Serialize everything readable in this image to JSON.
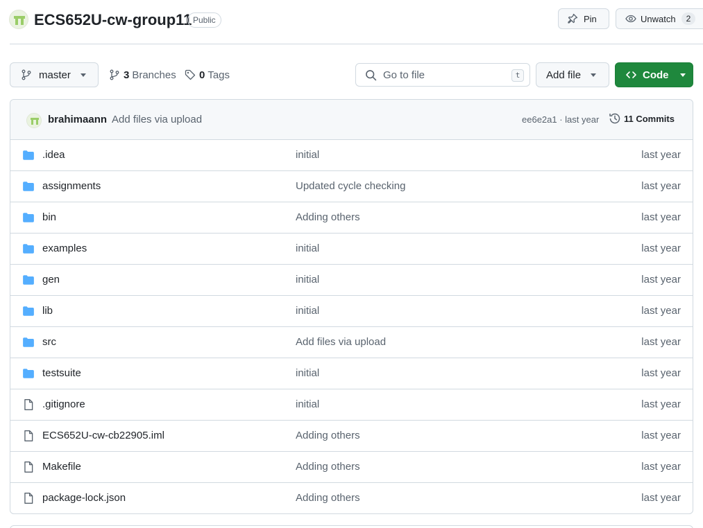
{
  "repo": {
    "name": "ECS652U-cw-group11",
    "visibility": "Public"
  },
  "actions": {
    "pin_label": "Pin",
    "watch_label": "Unwatch",
    "watch_count": "2"
  },
  "toolbar": {
    "branch": "master",
    "branches_count": "3",
    "branches_label": "Branches",
    "tags_count": "0",
    "tags_label": "Tags",
    "search_placeholder": "Go to file",
    "search_shortcut": "t",
    "add_file_label": "Add file",
    "code_label": "Code"
  },
  "latest_commit": {
    "author": "brahimaann",
    "message": "Add files via upload",
    "meta": "ee6e2a1 · last year",
    "commits_label": "11 Commits"
  },
  "files": [
    {
      "name": ".idea",
      "type": "folder",
      "message": "initial",
      "age": "last year"
    },
    {
      "name": "assignments",
      "type": "folder",
      "message": "Updated cycle checking",
      "age": "last year"
    },
    {
      "name": "bin",
      "type": "folder",
      "message": "Adding others",
      "age": "last year"
    },
    {
      "name": "examples",
      "type": "folder",
      "message": "initial",
      "age": "last year"
    },
    {
      "name": "gen",
      "type": "folder",
      "message": "initial",
      "age": "last year"
    },
    {
      "name": "lib",
      "type": "folder",
      "message": "initial",
      "age": "last year"
    },
    {
      "name": "src",
      "type": "folder",
      "message": "Add files via upload",
      "age": "last year"
    },
    {
      "name": "testsuite",
      "type": "folder",
      "message": "initial",
      "age": "last year"
    },
    {
      "name": ".gitignore",
      "type": "file",
      "message": "initial",
      "age": "last year"
    },
    {
      "name": "ECS652U-cw-cb22905.iml",
      "type": "file",
      "message": "Adding others",
      "age": "last year"
    },
    {
      "name": "Makefile",
      "type": "file",
      "message": "Adding others",
      "age": "last year"
    },
    {
      "name": "package-lock.json",
      "type": "file",
      "message": "Adding others",
      "age": "last year"
    }
  ],
  "colors": {
    "folder_icon": "#54aeff",
    "file_icon": "#59636e",
    "code_button": "#1f883d",
    "avatar_accent": "#9acd68"
  }
}
